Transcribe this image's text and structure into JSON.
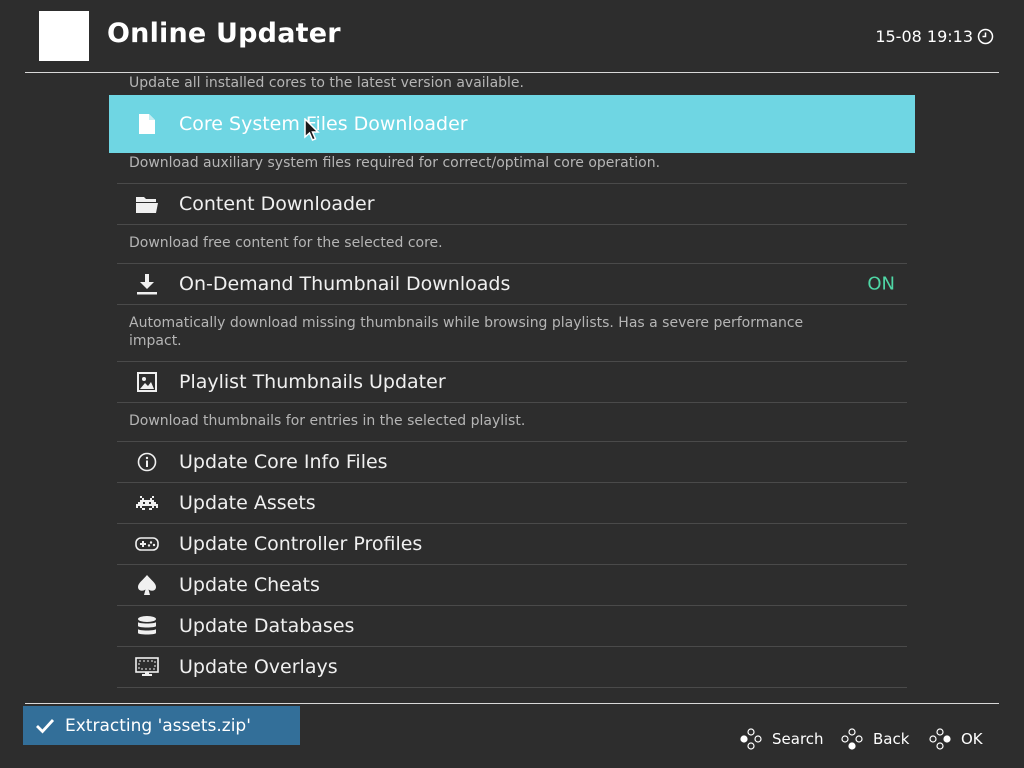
{
  "header": {
    "title": "Online Updater",
    "clock": "15-08 19:13"
  },
  "items": [
    {
      "sublabel": "Update all installed cores to the latest version available."
    },
    {
      "label": "Core System Files Downloader",
      "icon": "file-icon",
      "sublabel": "Download auxiliary system files required for correct/optimal core operation."
    },
    {
      "label": "Content Downloader",
      "icon": "folder-icon",
      "sublabel": "Download free content for the selected core."
    },
    {
      "label": "On-Demand Thumbnail Downloads",
      "icon": "download-icon",
      "value": "ON",
      "sublabel": "Automatically download missing thumbnails while browsing playlists. Has a severe performance impact."
    },
    {
      "label": "Playlist Thumbnails Updater",
      "icon": "image-icon",
      "sublabel": "Download thumbnails for entries in the selected playlist."
    },
    {
      "label": "Update Core Info Files",
      "icon": "info-icon"
    },
    {
      "label": "Update Assets",
      "icon": "invader-icon"
    },
    {
      "label": "Update Controller Profiles",
      "icon": "gamepad-icon"
    },
    {
      "label": "Update Cheats",
      "icon": "spade-icon"
    },
    {
      "label": "Update Databases",
      "icon": "database-icon"
    },
    {
      "label": "Update Overlays",
      "icon": "monitor-icon"
    }
  ],
  "colors": {
    "selection": "#6fd6e3",
    "toast": "#336f99",
    "on_value": "#4fd6a5",
    "background": "#2d2d2d"
  },
  "toast": {
    "message": "Extracting 'assets.zip'",
    "icon": "checkmark-icon"
  },
  "footer": {
    "search_label": "Search",
    "back_label": "Back",
    "ok_label": "OK"
  }
}
